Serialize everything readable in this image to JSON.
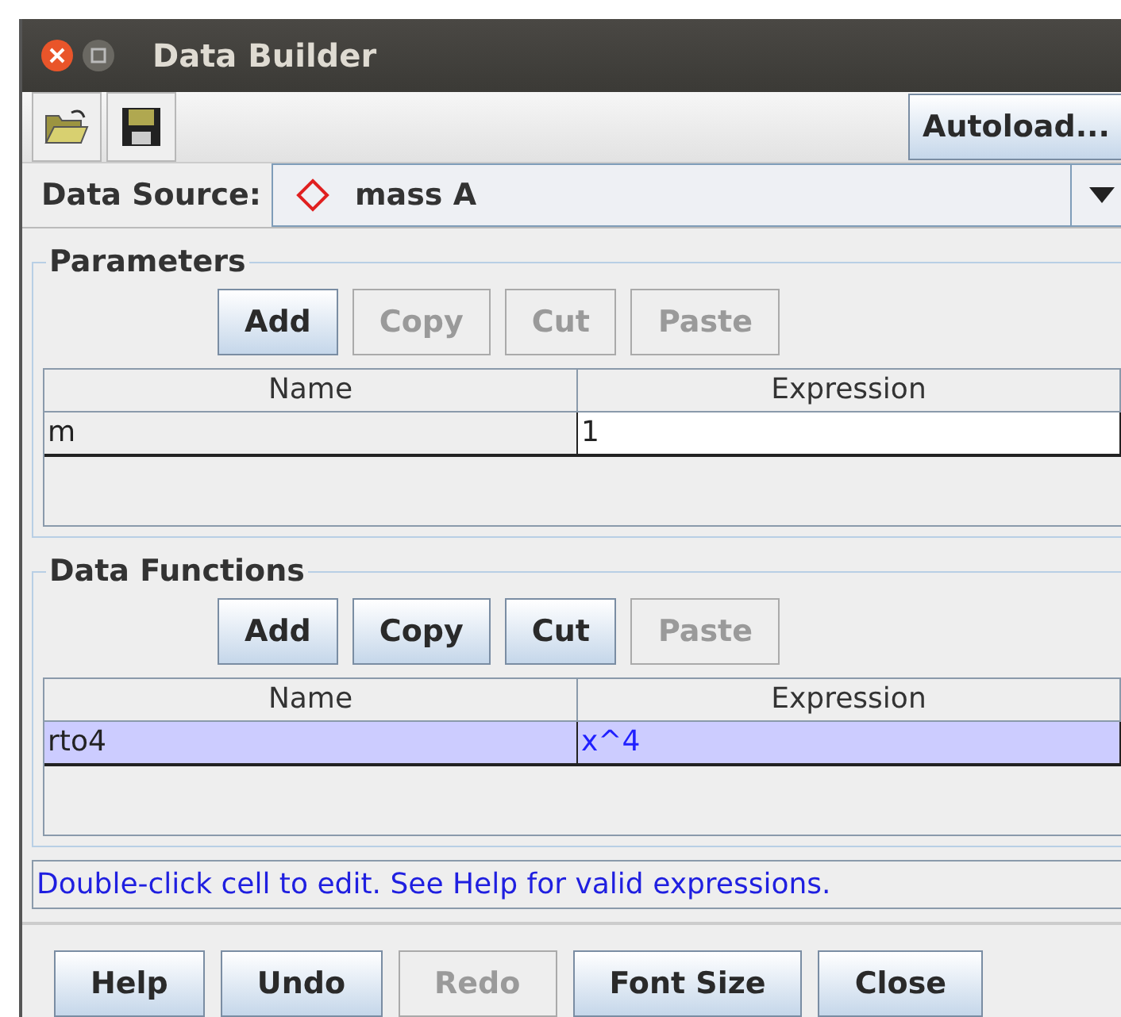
{
  "window": {
    "title": "Data Builder"
  },
  "toolbar": {
    "autoload_button": "Autoload..."
  },
  "data_source": {
    "label": "Data Source:",
    "value": "mass A"
  },
  "parameters": {
    "title": "Parameters",
    "buttons": [
      {
        "label": "Add",
        "disabled": false
      },
      {
        "label": "Copy",
        "disabled": true
      },
      {
        "label": "Cut",
        "disabled": true
      },
      {
        "label": "Paste",
        "disabled": true
      }
    ],
    "columns": [
      "Name",
      "Expression"
    ],
    "rows": [
      {
        "cells": [
          "m",
          "1"
        ],
        "selected": false
      }
    ]
  },
  "data_functions": {
    "title": "Data Functions",
    "buttons": [
      {
        "label": "Add",
        "disabled": false
      },
      {
        "label": "Copy",
        "disabled": false
      },
      {
        "label": "Cut",
        "disabled": false
      },
      {
        "label": "Paste",
        "disabled": true
      }
    ],
    "columns": [
      "Name",
      "Expression"
    ],
    "rows": [
      {
        "cells": [
          "rto4",
          "x^4"
        ],
        "selected": true
      }
    ]
  },
  "message": "Double-click cell to edit. See Help for valid expressions.",
  "buttons": [
    {
      "label": "Help",
      "disabled": false
    },
    {
      "label": "Undo",
      "disabled": false
    },
    {
      "label": "Redo",
      "disabled": true
    },
    {
      "label": "Font Size",
      "disabled": false
    },
    {
      "label": "Close",
      "disabled": false
    }
  ]
}
